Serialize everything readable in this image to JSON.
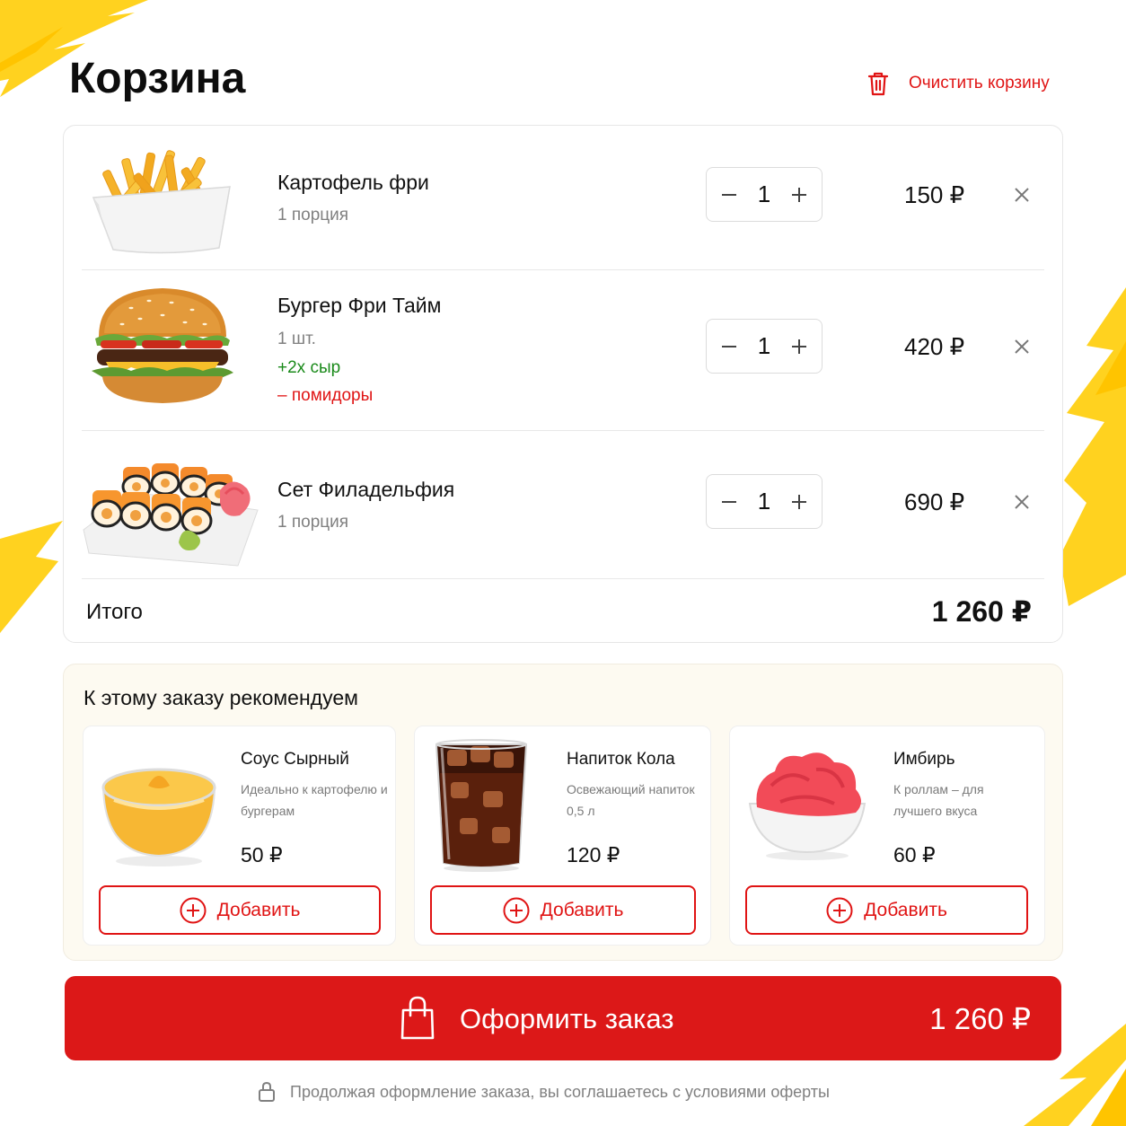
{
  "header": {
    "title": "Корзина",
    "clear_label": "Очистить корзину"
  },
  "cart": {
    "items": [
      {
        "name": "Картофель фри",
        "unit": "1 порция",
        "modifiers_add": "",
        "modifiers_remove": "",
        "qty": "1",
        "price": "150 ₽",
        "image": "fries-image"
      },
      {
        "name": "Бургер Фри Тайм",
        "unit": "1 шт.",
        "modifiers_add": "+2х сыр",
        "modifiers_remove": "– помидоры",
        "qty": "1",
        "price": "420 ₽",
        "image": "burger-image"
      },
      {
        "name": "Сет Филадельфия",
        "unit": "1 порция",
        "modifiers_add": "",
        "modifiers_remove": "",
        "qty": "1",
        "price": "690 ₽",
        "image": "sushi-image"
      }
    ],
    "total_label": "Итого",
    "total_value": "1 260 ₽"
  },
  "recommendations": {
    "title": "К этому заказу рекомендуем",
    "items": [
      {
        "name": "Соус Сырный",
        "desc": "Идеально к картофелю и бургерам",
        "price": "50 ₽",
        "add_label": "Добавить",
        "image": "cheese-sauce-image"
      },
      {
        "name": "Напиток Кола",
        "desc": "Освежающий напиток 0,5 л",
        "price": "120 ₽",
        "add_label": "Добавить",
        "image": "cola-image"
      },
      {
        "name": "Имбирь",
        "desc": "К роллам – для лучшего вкуса",
        "price": "60 ₽",
        "add_label": "Добавить",
        "image": "ginger-image"
      }
    ]
  },
  "checkout": {
    "label": "Оформить заказ",
    "total": "1 260 ₽"
  },
  "footer": {
    "note": "Продолжая оформление заказа, вы соглашаетесь с условиями оферты"
  },
  "colors": {
    "accent": "#dc1818",
    "brush": "#ffd21f",
    "modifier_add": "#1a8a1a",
    "modifier_remove": "#e01414"
  }
}
